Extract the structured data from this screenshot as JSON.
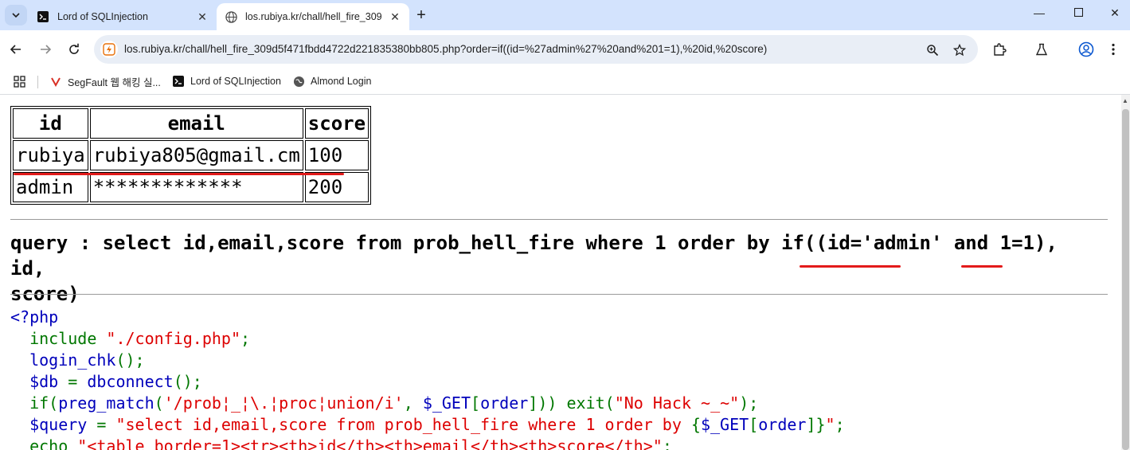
{
  "browser": {
    "tabs": [
      {
        "title": "Lord of SQLInjection",
        "active": false
      },
      {
        "title": "los.rubiya.kr/chall/hell_fire_309",
        "active": true
      }
    ],
    "url": "los.rubiya.kr/chall/hell_fire_309d5f471fbdd4722d221835380bb805.php?order=if((id=%27admin%27%20and%201=1),%20id,%20score)",
    "bookmarks": [
      {
        "label": "SegFault 웹 해킹 실..."
      },
      {
        "label": "Lord of SQLInjection"
      },
      {
        "label": "Almond Login"
      }
    ]
  },
  "page": {
    "table": {
      "headers": [
        "id",
        "email",
        "score"
      ],
      "rows": [
        [
          "rubiya",
          "rubiya805@gmail.cm",
          "100"
        ],
        [
          "admin",
          "*************",
          "200"
        ]
      ]
    },
    "query_label": "query : ",
    "query_pre": "select id,email,score from prob_hell_fire where 1 order by if((",
    "query_cond1": "id='admin'",
    "query_and": " and ",
    "query_cond2": "1=1",
    "query_post": "), id,",
    "query_line2": "score)",
    "code": {
      "l1": "<?php",
      "l2a": "  include ",
      "l2b": "\"./config.php\"",
      "l2c": ";",
      "l3a": "  login_chk",
      "l3b": "();",
      "l4a": "  $db",
      "l4b": " = ",
      "l4c": "dbconnect",
      "l4d": "();",
      "l5a": "  if(",
      "l5b": "preg_match",
      "l5c": "(",
      "l5d": "'/prob¦_¦\\.¦proc¦union/i'",
      "l5e": ", ",
      "l5f": "$_GET",
      "l5g": "[",
      "l5h": "order",
      "l5i": "])) ",
      "l5j": "exit(",
      "l5k": "\"No Hack ~_~\"",
      "l5l": ");",
      "l6a": "  $query",
      "l6b": " = ",
      "l6c": "\"select id,email,score from prob_hell_fire where 1 order by ",
      "l6d": "{",
      "l6e": "$_GET",
      "l6f": "[",
      "l6g": "order",
      "l6h": "]}",
      "l6i": "\"",
      "l6j": ";",
      "l7a": "  echo ",
      "l7b": "\"<table border=1><tr><th>id</th><th>email</th><th>score</th>\"",
      "l7c": ";"
    }
  },
  "colors": {
    "tabbar": "#d3e3fd",
    "annotation": "#e31b1b",
    "php_keyword": "#0000bb",
    "php_default": "#007700",
    "php_string": "#dd0000"
  }
}
